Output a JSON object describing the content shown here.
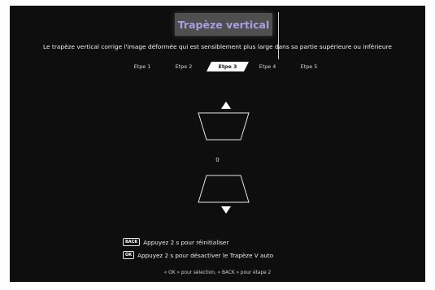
{
  "title": "Trapèze vertical",
  "description": "Le trapèze vertical corrige l'image déformée qui est sensiblement plus large dans sa partie supérieure ou inférieure",
  "steps": [
    {
      "label": "Etpe 1",
      "active": false
    },
    {
      "label": "Etpe 2",
      "active": false
    },
    {
      "label": "Etpe 3",
      "active": true
    },
    {
      "label": "Etpe 4",
      "active": false
    },
    {
      "label": "Etpe 5",
      "active": false
    }
  ],
  "keystone_value": "0",
  "hints": {
    "back": {
      "key": "BACK",
      "text": "Appuyez 2 s pour réinitialiser"
    },
    "ok": {
      "key": "OK",
      "text": "Appuyez 2 s pour désactiver le Trapèze V auto"
    }
  },
  "footer": "« OK » pour sélection, « BACK » pour étape 2",
  "colors": {
    "background": "#0e0e0e",
    "title_text": "#a89ee2",
    "title_box": "#4f4f4f",
    "active_step": "#ffffff"
  }
}
